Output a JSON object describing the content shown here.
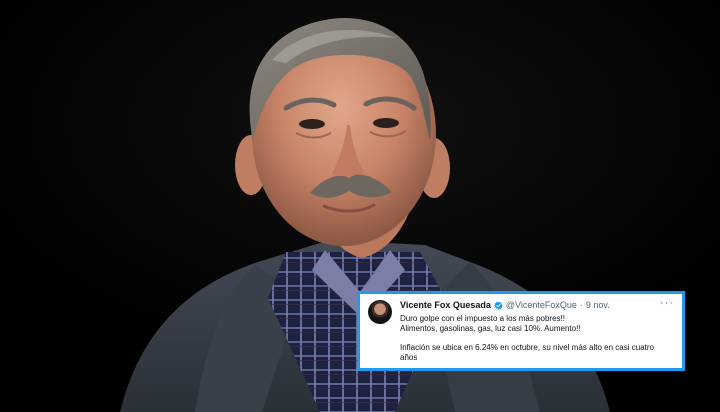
{
  "tweet": {
    "author_name": "Vicente Fox Quesada",
    "author_handle": "@VicenteFoxQue",
    "separator": "·",
    "date": "9 nov.",
    "more_icon": "more-horizontal-icon",
    "verified_icon": "verified-badge-icon",
    "lines": [
      "Duro golpe con el impuesto a los más pobres!!",
      "Alimentos, gasolinas, gas, luz casi 10%. Aumento!!"
    ],
    "quote_lines": [
      "Inflación se ubica en 6.24% en octubre, su nivel más alto en casi cuatro",
      "años"
    ]
  },
  "colors": {
    "background": "#030303",
    "tweet_border": "#1d9bf0",
    "tweet_background": "#ffffff",
    "text_primary": "#0f1419",
    "text_secondary": "#536471"
  }
}
